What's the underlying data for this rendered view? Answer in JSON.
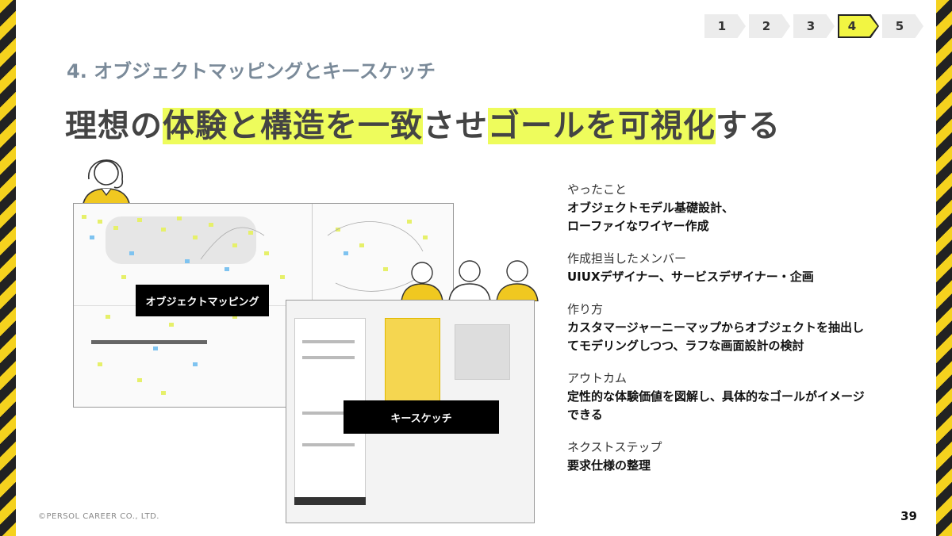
{
  "steps": [
    "1",
    "2",
    "3",
    "4",
    "5"
  ],
  "active_step": "4",
  "subtitle": "4. オブジェクトマッピングとキースケッチ",
  "title": {
    "p1": "理想の",
    "p2": "体験と構造を一致",
    "p3": "させ",
    "p4": "ゴールを可視化",
    "p5": "する"
  },
  "labels": {
    "object_mapping": "オブジェクトマッピング",
    "key_sketch": "キースケッチ"
  },
  "info": [
    {
      "head": "やったこと",
      "body": "オブジェクトモデル基礎設計、\nローファイなワイヤー作成"
    },
    {
      "head": "作成担当したメンバー",
      "body": "UIUXデザイナー、サービスデザイナー・企画"
    },
    {
      "head": "作り方",
      "body": "カスタマージャーニーマップからオブジェクトを抽出し\nてモデリングしつつ、ラフな画面設計の検討"
    },
    {
      "head": "アウトカム",
      "body": "定性的な体験価値を図解し、具体的なゴールがイメージ\nできる"
    },
    {
      "head": "ネクストステップ",
      "body": "要求仕様の整理"
    }
  ],
  "footer": "©PERSOL CAREER CO., LTD.",
  "page_number": "39",
  "colors": {
    "highlight": "#eefc5c",
    "stripe_yellow": "#f5d21e",
    "subtitle": "#7a8a99"
  }
}
